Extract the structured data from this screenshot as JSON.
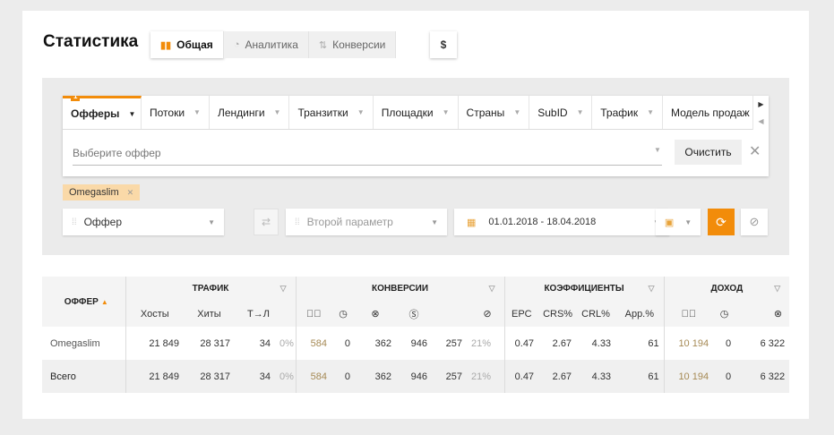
{
  "page": {
    "title": "Статистика"
  },
  "tabs": [
    {
      "label": "Общая",
      "icon": "bar-chart-icon",
      "active": true
    },
    {
      "label": "Аналитика",
      "icon": "pie-chart-icon",
      "active": false
    },
    {
      "label": "Конверсии",
      "icon": "sort-arrows-icon",
      "active": false
    }
  ],
  "currency": {
    "label": "$"
  },
  "filter": {
    "tabs": [
      {
        "label": "Офферы",
        "active": true,
        "badge": "1"
      },
      {
        "label": "Потоки"
      },
      {
        "label": "Лендинги"
      },
      {
        "label": "Транзитки"
      },
      {
        "label": "Площадки"
      },
      {
        "label": "Страны"
      },
      {
        "label": "SubID"
      },
      {
        "label": "Трафик"
      },
      {
        "label": "Модель продаж"
      }
    ],
    "placeholder": "Выберите оффер",
    "clear_label": "Очистить",
    "chips": [
      {
        "label": "Omegaslim"
      }
    ]
  },
  "controls": {
    "param1": "Оффер",
    "param2": "Второй параметр",
    "date_range": "01.01.2018 - 18.04.2018"
  },
  "table": {
    "groups": [
      "ОФФЕР",
      "ТРАФИК",
      "КОНВЕРСИИ",
      "КОЭФФИЦИЕНТЫ",
      "ДОХОД"
    ],
    "traffic_cols": [
      "Хосты",
      "Хиты",
      "Т→Л"
    ],
    "coef_cols": [
      "EPC",
      "CRS%",
      "CRL%",
      "App.%"
    ],
    "rows": [
      {
        "name": "Omegaslim",
        "hosts": "21 849",
        "hits": "28 317",
        "tl": "34",
        "tl_pct": "0%",
        "conv_ok": "584",
        "conv_wait": "0",
        "conv_no": "362",
        "conv_sum": "946",
        "conv_trash": "257",
        "conv_trash_pct": "21%",
        "epc": "0.47",
        "crs": "2.67",
        "crl": "4.33",
        "app": "61",
        "inc_ok": "10 194",
        "inc_wait": "0",
        "inc_no": "6 322"
      },
      {
        "name": "Всего",
        "hosts": "21 849",
        "hits": "28 317",
        "tl": "34",
        "tl_pct": "0%",
        "conv_ok": "584",
        "conv_wait": "0",
        "conv_no": "362",
        "conv_sum": "946",
        "conv_trash": "257",
        "conv_trash_pct": "21%",
        "epc": "0.47",
        "crs": "2.67",
        "crl": "4.33",
        "app": "61",
        "inc_ok": "10 194",
        "inc_wait": "0",
        "inc_no": "6 322"
      }
    ]
  },
  "colors": {
    "accent": "#f28c0a",
    "chip": "#fad9a8",
    "approved": "#8bb63d",
    "rejected": "#f27a4a"
  }
}
